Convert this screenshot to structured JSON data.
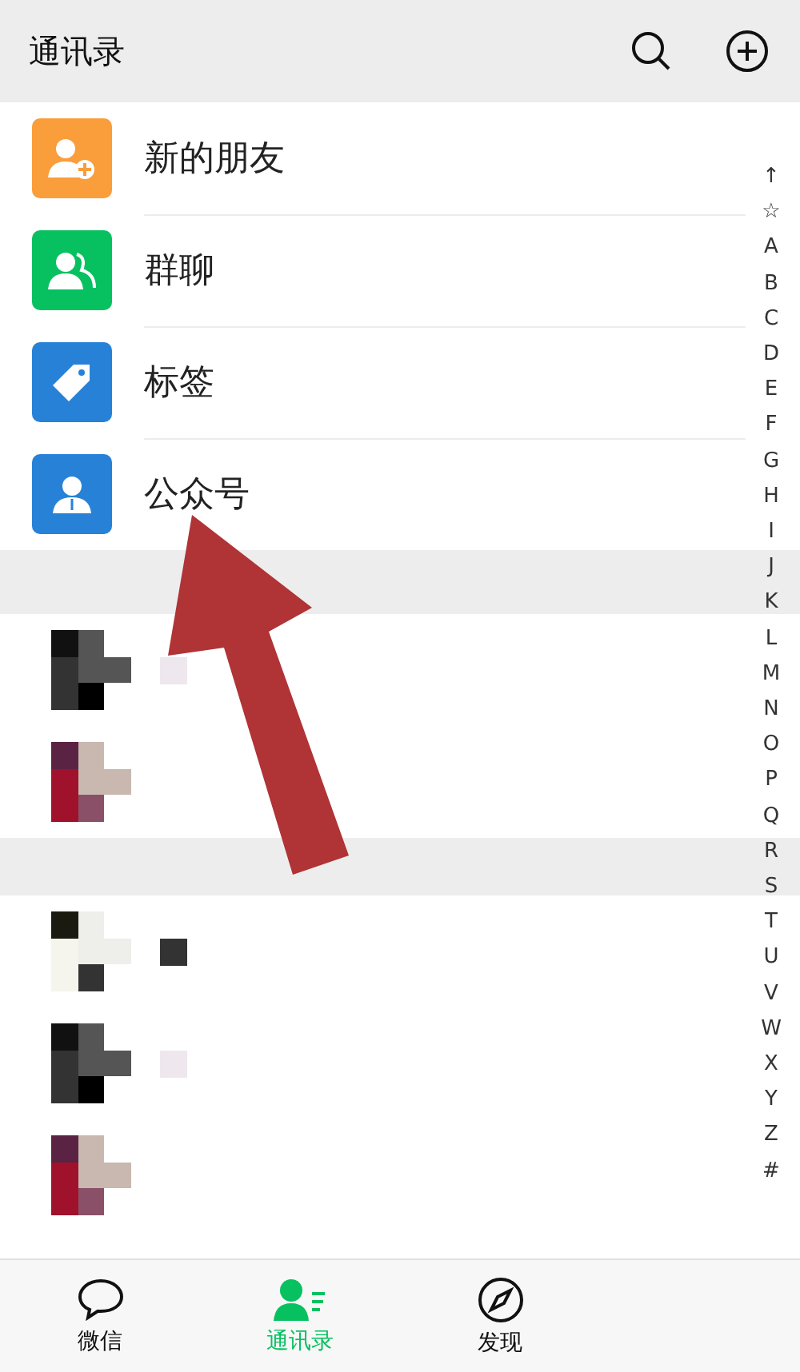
{
  "header": {
    "title": "通讯录"
  },
  "entries": [
    {
      "label": "新的朋友",
      "kind": "new-friend",
      "color": "#fa9d3b"
    },
    {
      "label": "群聊",
      "kind": "group",
      "color": "#07c160"
    },
    {
      "label": "标签",
      "kind": "tag",
      "color": "#2782d7"
    },
    {
      "label": "公众号",
      "kind": "official",
      "color": "#2782d7"
    }
  ],
  "index": [
    "↑",
    "☆",
    "A",
    "B",
    "C",
    "D",
    "E",
    "F",
    "G",
    "H",
    "I",
    "J",
    "K",
    "L",
    "M",
    "N",
    "O",
    "P",
    "Q",
    "R",
    "S",
    "T",
    "U",
    "V",
    "W",
    "X",
    "Y",
    "Z",
    "#"
  ],
  "tabs": [
    {
      "label": "微信",
      "kind": "chat",
      "selected": false
    },
    {
      "label": "通讯录",
      "kind": "contacts",
      "selected": true
    },
    {
      "label": "发现",
      "kind": "discover",
      "selected": false
    }
  ]
}
